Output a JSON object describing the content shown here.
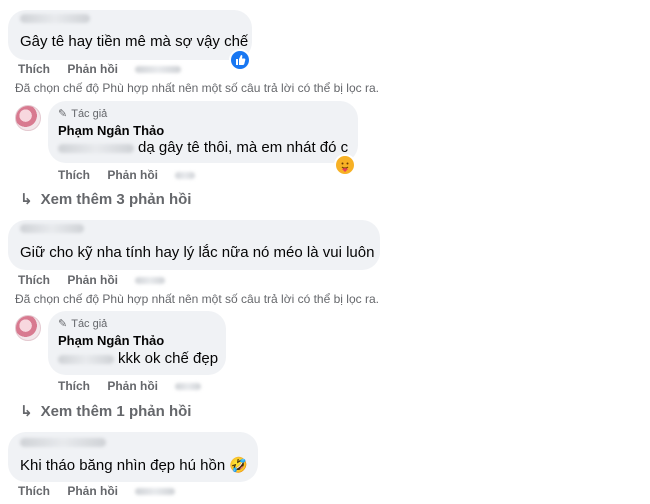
{
  "labels": {
    "like": "Thích",
    "reply": "Phản hồi",
    "author_badge": "Tác giả",
    "filter_note": "Đã chọn chế độ Phù hợp nhất nên một số câu trả lời có thể bị lọc ra."
  },
  "comments": [
    {
      "text": "Gây tê hay tiền mê mà sợ vậy chế",
      "reaction": "like"
    },
    {
      "text": "Giữ cho kỹ nha tính hay lý lắc nữa nó méo là vui luôn"
    },
    {
      "text": "Khi tháo băng nhìn đẹp hú hồn 🤣"
    }
  ],
  "replies": [
    {
      "author": "Phạm Ngân Thảo",
      "text": "dạ gây tê thôi, mà em nhát đó c",
      "reaction": "care"
    },
    {
      "author": "Phạm Ngân Thảo",
      "text": "kkk ok chế đẹp"
    }
  ],
  "view_more": [
    "Xem thêm 3 phản hồi",
    "Xem thêm 1 phản hồi"
  ],
  "colors": {
    "bubble": "#f0f2f5",
    "meta": "#65676b",
    "like_blue": "#1877f2"
  }
}
